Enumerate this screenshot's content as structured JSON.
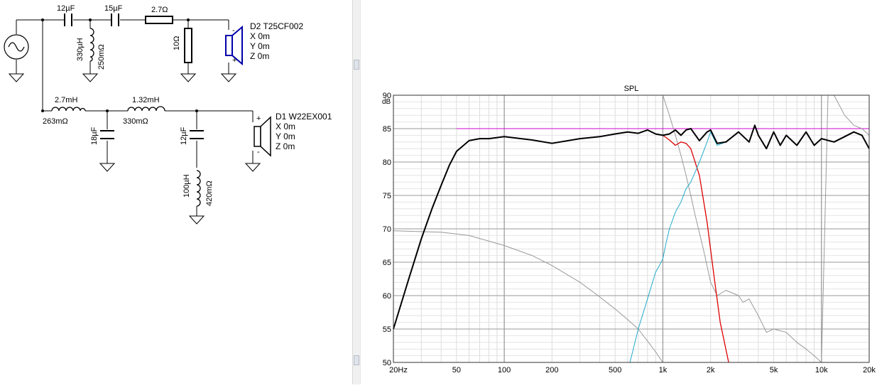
{
  "schematic": {
    "c_series_1": "12µF",
    "c_series_2": "15µF",
    "r_series": "2.7Ω",
    "l_shunt_value": "330µH",
    "l_shunt_resistance": "250mΩ",
    "r_shunt": "10Ω",
    "tweeter": {
      "name": "D2 T25CF002",
      "x": "X 0m",
      "y": "Y 0m",
      "z": "Z 0m"
    },
    "l_series_1_value": "2.7mH",
    "l_series_1_resistance": "263mΩ",
    "l_series_2_value": "1.32mH",
    "l_series_2_resistance": "330mΩ",
    "c_shunt_1": "18µF",
    "c_shunt_2": "12µF",
    "l_shunt_2_value": "100µH",
    "l_shunt_2_resistance": "420mΩ",
    "woofer": {
      "name": "D1 W22EX001",
      "x": "X 0m",
      "y": "Y 0m",
      "z": "Z 0m"
    },
    "polarity_plus": "+",
    "polarity_minus": "-"
  },
  "chart_data": {
    "type": "line",
    "title": "SPL",
    "ylabel": "dB",
    "x_scale": "log",
    "xlim": [
      20,
      20000
    ],
    "ylim": [
      50,
      90
    ],
    "x_ticks": [
      {
        "v": 20,
        "label": "20Hz"
      },
      {
        "v": 50,
        "label": "50"
      },
      {
        "v": 100,
        "label": "100"
      },
      {
        "v": 200,
        "label": "200"
      },
      {
        "v": 500,
        "label": "500"
      },
      {
        "v": 1000,
        "label": "1k"
      },
      {
        "v": 2000,
        "label": "2k"
      },
      {
        "v": 5000,
        "label": "5k"
      },
      {
        "v": 10000,
        "label": "10k"
      },
      {
        "v": 20000,
        "label": "20k"
      }
    ],
    "y_ticks": [
      {
        "v": 90,
        "label": "90"
      },
      {
        "v": 85,
        "label": "85"
      },
      {
        "v": 80,
        "label": "80"
      },
      {
        "v": 75,
        "label": "75"
      },
      {
        "v": 70,
        "label": "70"
      },
      {
        "v": 65,
        "label": "65"
      },
      {
        "v": 60,
        "label": "60"
      },
      {
        "v": 55,
        "label": "55"
      },
      {
        "v": 50,
        "label": "50"
      }
    ],
    "grid": true,
    "series": [
      {
        "color": "#d000d0",
        "role": "target",
        "x": [
          50,
          20000
        ],
        "y": [
          85,
          85
        ]
      },
      {
        "color": "#999999",
        "role": "woofer_raw",
        "x": [
          20,
          40,
          60,
          100,
          150,
          200,
          300,
          400,
          500,
          600,
          700,
          800,
          900,
          1000
        ],
        "y": [
          69.7,
          69.5,
          69.0,
          67.5,
          66.0,
          64.5,
          62.0,
          59.8,
          58.0,
          56.4,
          55.0,
          53.2,
          51.6,
          50.0
        ]
      },
      {
        "color": "#999999",
        "role": "tweeter_raw",
        "x": [
          1000,
          1100,
          1200,
          1300,
          1400,
          1500,
          1600,
          1800,
          2000,
          2200,
          2500,
          3000,
          3200,
          3500,
          4000,
          4500,
          5000,
          6000,
          7000,
          8000,
          9000,
          10000,
          11000,
          12000,
          14000,
          16000,
          18000,
          20000
        ],
        "y": [
          90.0,
          87.0,
          84.0,
          81.0,
          78.0,
          75.0,
          72.0,
          67.0,
          62.0,
          60.0,
          60.8,
          60.0,
          59.0,
          59.5,
          57.0,
          54.5,
          55.0,
          54.5,
          53.0,
          52.0,
          51.0,
          50.0,
          90.0,
          90.0,
          87.0,
          85.5,
          85.0,
          84.0
        ]
      },
      {
        "color": "#dd0000",
        "role": "woofer_filtered",
        "x": [
          20,
          25,
          30,
          35,
          40,
          45,
          50,
          60,
          70,
          80,
          100,
          150,
          200,
          300,
          400,
          500,
          600,
          700,
          800,
          900,
          1000,
          1100,
          1200,
          1300,
          1400,
          1500,
          1700,
          1900,
          2100,
          2300,
          2600
        ],
        "y": [
          55.0,
          62.5,
          68.5,
          73.0,
          76.5,
          79.5,
          81.6,
          83.2,
          83.5,
          83.5,
          83.8,
          83.3,
          82.8,
          83.5,
          83.8,
          84.2,
          84.5,
          84.3,
          84.8,
          84.2,
          84.0,
          83.3,
          82.5,
          83.0,
          82.8,
          82.0,
          78.0,
          71.0,
          63.0,
          56.0,
          50.0
        ]
      },
      {
        "color": "#22aacc",
        "role": "tweeter_filtered",
        "x": [
          620,
          700,
          800,
          900,
          950,
          1000,
          1050,
          1100,
          1200,
          1300,
          1400,
          1500,
          1600,
          1700,
          1800,
          1900,
          2000,
          2200,
          2500,
          3000,
          3500,
          3800,
          4000,
          4500,
          5000,
          5500,
          6000,
          7000,
          8000,
          9000,
          10000,
          12000,
          14000,
          16000,
          18000,
          20000
        ],
        "y": [
          50.0,
          55.0,
          59.5,
          63.5,
          64.5,
          65.5,
          68.0,
          70.0,
          72.5,
          74.0,
          76.0,
          77.0,
          78.5,
          80.0,
          81.5,
          83.0,
          84.5,
          82.5,
          83.0,
          84.5,
          83.0,
          85.5,
          84.0,
          82.0,
          84.5,
          82.5,
          84.0,
          82.5,
          84.5,
          82.5,
          83.5,
          83.0,
          83.8,
          84.5,
          84.0,
          82.0
        ]
      },
      {
        "color": "#000000",
        "role": "system_sum",
        "x": [
          20,
          25,
          30,
          35,
          40,
          45,
          50,
          60,
          70,
          80,
          100,
          150,
          200,
          300,
          400,
          500,
          600,
          700,
          800,
          900,
          1000,
          1100,
          1200,
          1300,
          1400,
          1500,
          1700,
          1900,
          2000,
          2200,
          2500,
          3000,
          3500,
          3800,
          4000,
          4500,
          5000,
          5500,
          6000,
          7000,
          8000,
          9000,
          10000,
          12000,
          14000,
          16000,
          18000,
          20000
        ],
        "y": [
          55.0,
          62.5,
          68.5,
          73.0,
          76.5,
          79.5,
          81.6,
          83.2,
          83.5,
          83.5,
          83.8,
          83.3,
          82.8,
          83.5,
          83.8,
          84.2,
          84.5,
          84.3,
          84.8,
          84.2,
          84.0,
          84.2,
          84.8,
          84.0,
          84.8,
          85.0,
          83.2,
          84.5,
          84.8,
          82.8,
          83.0,
          84.5,
          83.0,
          85.5,
          84.0,
          82.0,
          84.5,
          82.5,
          84.0,
          82.5,
          84.5,
          82.5,
          83.5,
          83.0,
          83.8,
          84.5,
          84.0,
          82.0
        ]
      }
    ]
  }
}
